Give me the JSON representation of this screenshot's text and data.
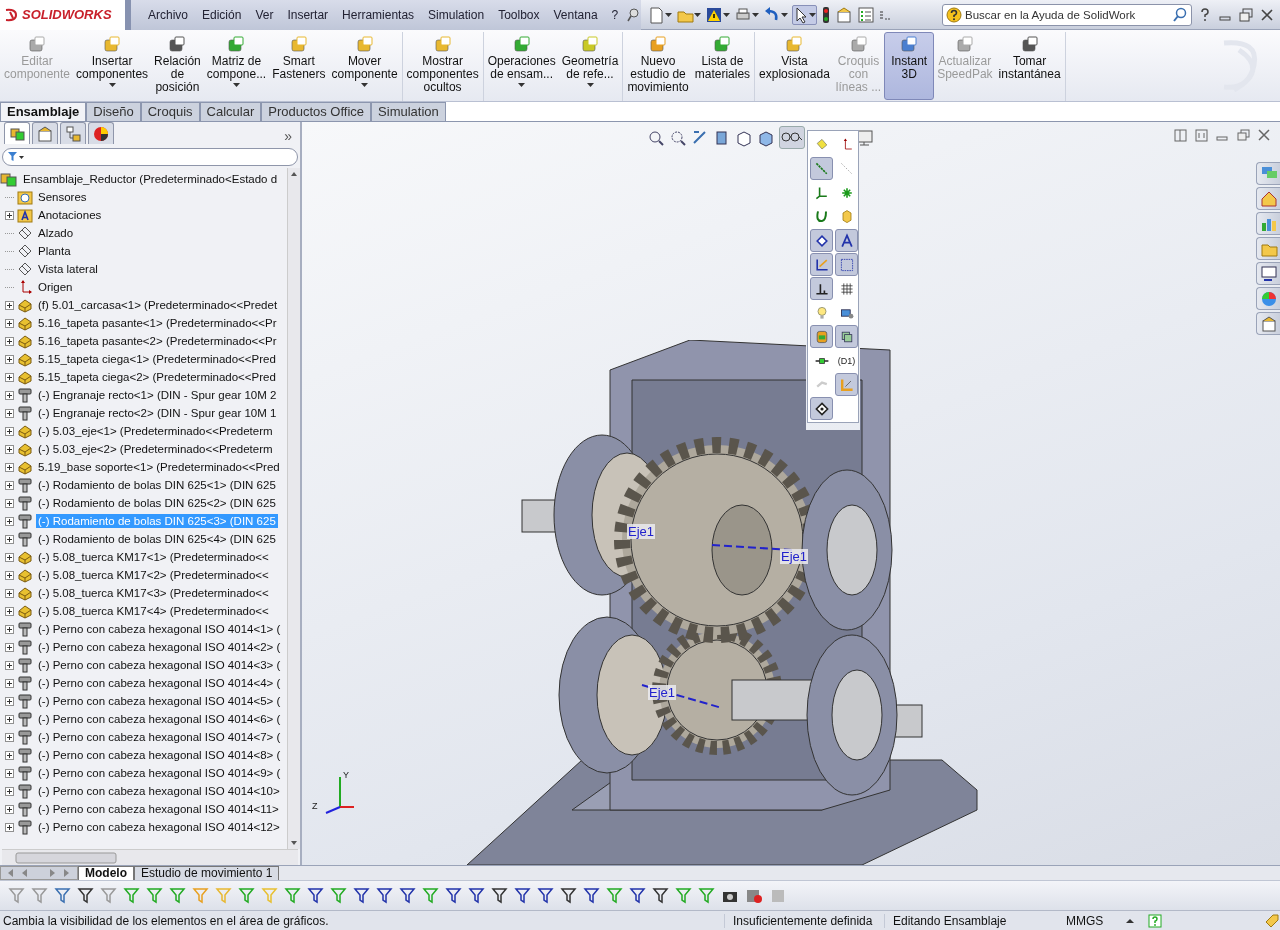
{
  "app": {
    "logo": "SOLIDWORKS"
  },
  "menu": [
    "Archivo",
    "Edición",
    "Ver",
    "Insertar",
    "Herramientas",
    "Simulation",
    "Toolbox",
    "Ventana",
    "?"
  ],
  "search": {
    "placeholder": "Buscar en la Ayuda de SolidWork"
  },
  "ribbon_groups": [
    [
      {
        "label": "Editar\ncomponente",
        "disabled": true,
        "selected": false,
        "dropdown": false
      },
      {
        "label": "Insertar\ncomponentes",
        "disabled": false,
        "selected": false,
        "dropdown": true
      },
      {
        "label": "Relación\nde\nposición",
        "disabled": false,
        "selected": false,
        "dropdown": false
      },
      {
        "label": "Matriz de\ncompone...",
        "disabled": false,
        "selected": false,
        "dropdown": true
      },
      {
        "label": "Smart\nFasteners",
        "disabled": false,
        "selected": false,
        "dropdown": false
      },
      {
        "label": "Mover\ncomponente",
        "disabled": false,
        "selected": false,
        "dropdown": true
      }
    ],
    [
      {
        "label": "Mostrar\ncomponentes\nocultos",
        "disabled": false,
        "selected": false,
        "dropdown": false
      }
    ],
    [
      {
        "label": "Operaciones\nde ensam...",
        "disabled": false,
        "selected": false,
        "dropdown": true
      },
      {
        "label": "Geometría\nde refe...",
        "disabled": false,
        "selected": false,
        "dropdown": true
      }
    ],
    [
      {
        "label": "Nuevo\nestudio de\nmovimiento",
        "disabled": false,
        "selected": false,
        "dropdown": false
      },
      {
        "label": "Lista de\nmateriales",
        "disabled": false,
        "selected": false,
        "dropdown": false
      }
    ],
    [
      {
        "label": "Vista\nexplosionada",
        "disabled": false,
        "selected": false,
        "dropdown": false
      },
      {
        "label": "Croquis\ncon\nlíneas ...",
        "disabled": true,
        "selected": false,
        "dropdown": false
      },
      {
        "label": "Instant\n3D",
        "disabled": false,
        "selected": true,
        "dropdown": false
      },
      {
        "label": "Actualizar\nSpeedPak",
        "disabled": true,
        "selected": false,
        "dropdown": false
      },
      {
        "label": "Tomar\ninstantánea",
        "disabled": false,
        "selected": false,
        "dropdown": false
      }
    ]
  ],
  "command_tabs": [
    {
      "label": "Ensamblaje",
      "selected": true
    },
    {
      "label": "Diseño",
      "selected": false
    },
    {
      "label": "Croquis",
      "selected": false
    },
    {
      "label": "Calcular",
      "selected": false
    },
    {
      "label": "Productos Office",
      "selected": false
    },
    {
      "label": "Simulation",
      "selected": false
    }
  ],
  "panel_tabs": [
    {
      "selected": true
    },
    {
      "selected": false
    },
    {
      "selected": false
    },
    {
      "selected": false
    }
  ],
  "panel_more": "»",
  "tree": {
    "label": "Ensamblaje_Reductor  (Predeterminado<Estado d",
    "kind": "assembly",
    "selected": false,
    "children": [
      {
        "label": "Sensores",
        "kind": "sensor-folder",
        "expandable": false,
        "selected": false
      },
      {
        "label": "Anotaciones",
        "kind": "annotation-folder",
        "expandable": true,
        "selected": false
      },
      {
        "label": "Alzado",
        "kind": "plane",
        "expandable": false,
        "selected": false
      },
      {
        "label": "Planta",
        "kind": "plane",
        "expandable": false,
        "selected": false
      },
      {
        "label": "Vista lateral",
        "kind": "plane",
        "expandable": false,
        "selected": false
      },
      {
        "label": "Origen",
        "kind": "origin",
        "expandable": false,
        "selected": false
      },
      {
        "label": "(f) 5.01_carcasa<1> (Predeterminado<<Predet",
        "kind": "part",
        "expandable": true,
        "selected": false
      },
      {
        "label": "5.16_tapeta pasante<1> (Predeterminado<<Pr",
        "kind": "part",
        "expandable": true,
        "selected": false
      },
      {
        "label": "5.16_tapeta pasante<2> (Predeterminado<<Pr",
        "kind": "part",
        "expandable": true,
        "selected": false
      },
      {
        "label": "5.15_tapeta ciega<1> (Predeterminado<<Pred",
        "kind": "part",
        "expandable": true,
        "selected": false
      },
      {
        "label": "5.15_tapeta ciega<2> (Predeterminado<<Pred",
        "kind": "part",
        "expandable": true,
        "selected": false
      },
      {
        "label": "(-) Engranaje recto<1> (DIN - Spur gear 10M 2",
        "kind": "toolbox-part",
        "expandable": true,
        "selected": false
      },
      {
        "label": "(-) Engranaje recto<2> (DIN - Spur gear 10M 1",
        "kind": "toolbox-part",
        "expandable": true,
        "selected": false
      },
      {
        "label": "(-) 5.03_eje<1> (Predeterminado<<Predeterm",
        "kind": "part",
        "expandable": true,
        "selected": false
      },
      {
        "label": "(-) 5.03_eje<2> (Predeterminado<<Predeterm",
        "kind": "part",
        "expandable": true,
        "selected": false
      },
      {
        "label": "5.19_base soporte<1> (Predeterminado<<Pred",
        "kind": "part",
        "expandable": true,
        "selected": false
      },
      {
        "label": "(-) Rodamiento de bolas DIN 625<1> (DIN 625",
        "kind": "toolbox-part",
        "expandable": true,
        "selected": false
      },
      {
        "label": "(-) Rodamiento de bolas DIN 625<2> (DIN 625",
        "kind": "toolbox-part",
        "expandable": true,
        "selected": false
      },
      {
        "label": "(-) Rodamiento de bolas DIN 625<3> (DIN 625",
        "kind": "toolbox-part",
        "expandable": true,
        "selected": true
      },
      {
        "label": "(-) Rodamiento de bolas DIN 625<4> (DIN 625",
        "kind": "toolbox-part",
        "expandable": true,
        "selected": false
      },
      {
        "label": "(-) 5.08_tuerca KM17<1> (Predeterminado<<",
        "kind": "part",
        "expandable": true,
        "selected": false
      },
      {
        "label": "(-) 5.08_tuerca KM17<2> (Predeterminado<<",
        "kind": "part",
        "expandable": true,
        "selected": false
      },
      {
        "label": "(-) 5.08_tuerca KM17<3> (Predeterminado<<",
        "kind": "part",
        "expandable": true,
        "selected": false
      },
      {
        "label": "(-) 5.08_tuerca KM17<4> (Predeterminado<<",
        "kind": "part",
        "expandable": true,
        "selected": false
      },
      {
        "label": "(-) Perno con cabeza hexagonal ISO 4014<1> (",
        "kind": "toolbox-part",
        "expandable": true,
        "selected": false
      },
      {
        "label": "(-) Perno con cabeza hexagonal ISO 4014<2> (",
        "kind": "toolbox-part",
        "expandable": true,
        "selected": false
      },
      {
        "label": "(-) Perno con cabeza hexagonal ISO 4014<3> (",
        "kind": "toolbox-part",
        "expandable": true,
        "selected": false
      },
      {
        "label": "(-) Perno con cabeza hexagonal ISO 4014<4> (",
        "kind": "toolbox-part",
        "expandable": true,
        "selected": false
      },
      {
        "label": "(-) Perno con cabeza hexagonal ISO 4014<5> (",
        "kind": "toolbox-part",
        "expandable": true,
        "selected": false
      },
      {
        "label": "(-) Perno con cabeza hexagonal ISO 4014<6> (",
        "kind": "toolbox-part",
        "expandable": true,
        "selected": false
      },
      {
        "label": "(-) Perno con cabeza hexagonal ISO 4014<7> (",
        "kind": "toolbox-part",
        "expandable": true,
        "selected": false
      },
      {
        "label": "(-) Perno con cabeza hexagonal ISO 4014<8> (",
        "kind": "toolbox-part",
        "expandable": true,
        "selected": false
      },
      {
        "label": "(-) Perno con cabeza hexagonal ISO 4014<9> (",
        "kind": "toolbox-part",
        "expandable": true,
        "selected": false
      },
      {
        "label": "(-) Perno con cabeza hexagonal ISO 4014<10>",
        "kind": "toolbox-part",
        "expandable": true,
        "selected": false
      },
      {
        "label": "(-) Perno con cabeza hexagonal ISO 4014<11>",
        "kind": "toolbox-part",
        "expandable": true,
        "selected": false
      },
      {
        "label": "(-) Perno con cabeza hexagonal ISO 4014<12>",
        "kind": "toolbox-part",
        "expandable": true,
        "selected": false
      }
    ]
  },
  "view_flyout": [
    {
      "kind": "icon",
      "pressed": false
    },
    {
      "kind": "icon",
      "pressed": false
    },
    {
      "kind": "icon",
      "pressed": true
    },
    {
      "kind": "icon",
      "pressed": false
    },
    {
      "kind": "icon",
      "pressed": false
    },
    {
      "kind": "icon",
      "pressed": false
    },
    {
      "kind": "icon",
      "pressed": false
    },
    {
      "kind": "icon",
      "pressed": false
    },
    {
      "kind": "icon",
      "pressed": true
    },
    {
      "kind": "icon",
      "pressed": true
    },
    {
      "kind": "icon",
      "pressed": true
    },
    {
      "kind": "icon",
      "pressed": true
    },
    {
      "kind": "icon",
      "pressed": true
    },
    {
      "kind": "icon",
      "pressed": false
    },
    {
      "kind": "icon",
      "pressed": false
    },
    {
      "kind": "icon",
      "pressed": false
    },
    {
      "kind": "icon",
      "pressed": true
    },
    {
      "kind": "icon",
      "pressed": true
    },
    {
      "kind": "icon",
      "pressed": false
    },
    {
      "kind": "text",
      "label": "(D1)",
      "pressed": false
    },
    {
      "kind": "icon",
      "pressed": false
    },
    {
      "kind": "icon",
      "pressed": true
    },
    {
      "kind": "icon",
      "pressed": true
    }
  ],
  "viewport": {
    "axis_labels": [
      "Eje1",
      "Eje1",
      "Eje1"
    ],
    "triad_labels": [
      "Y",
      "Z"
    ]
  },
  "bottom_tabs": [
    {
      "label": "Modelo",
      "selected": true
    },
    {
      "label": "Estudio de movimiento 1",
      "selected": false
    }
  ],
  "status_bar": {
    "message": "Cambia la visibilidad de los elementos en el área de gráficos.",
    "definition": "Insuficientemente definida",
    "mode": "Editando Ensamblaje",
    "units": "MMGS"
  }
}
